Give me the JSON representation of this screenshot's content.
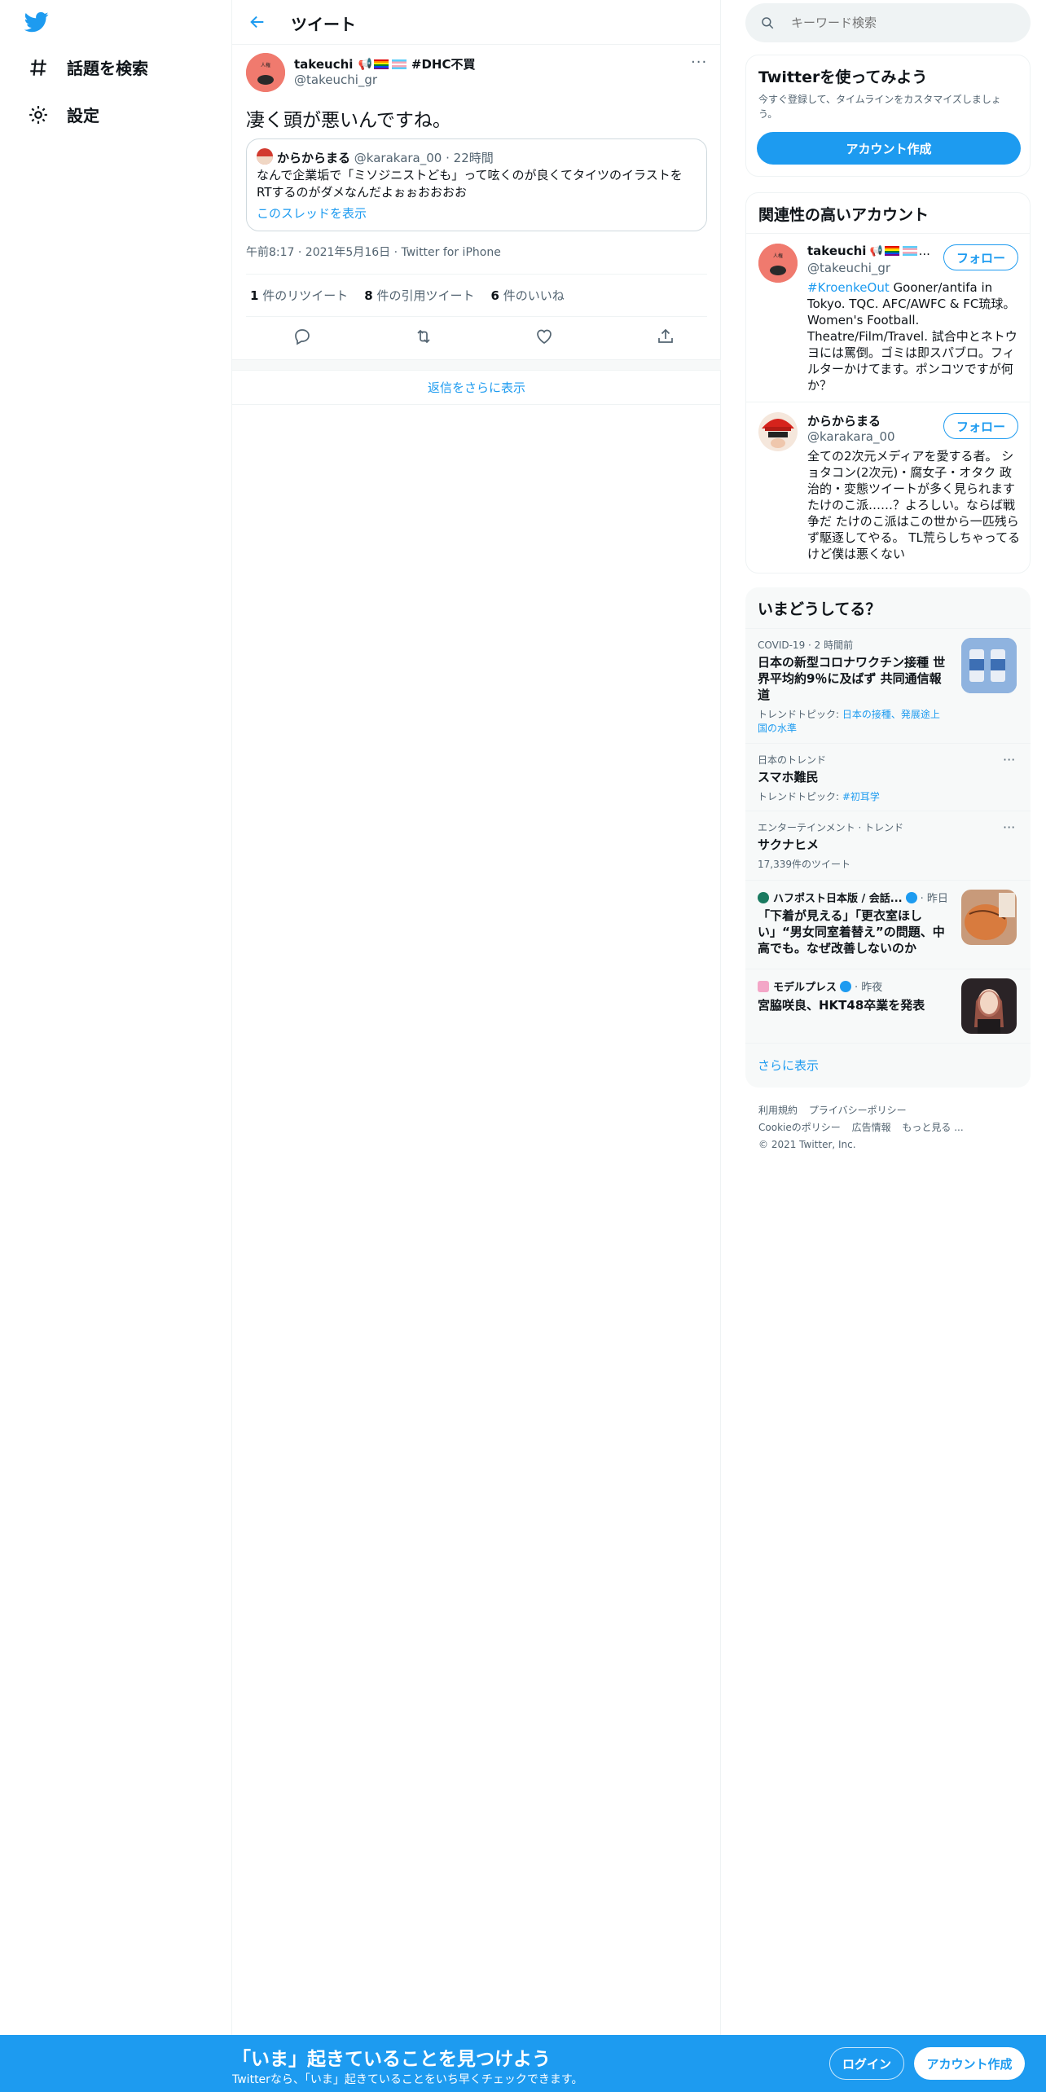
{
  "nav": {
    "explore_label": "話題を検索",
    "settings_label": "設定"
  },
  "header": {
    "title": "ツイート"
  },
  "tweet": {
    "author_name": "takeuchi",
    "author_hashtag": "#DHC不買",
    "author_handle": "@takeuchi_gr",
    "text": "凄く頭が悪いんですね。",
    "quote": {
      "name": "からからまる",
      "handle": "@karakara_00",
      "time": "· 22時間",
      "text": "なんで企業垢で「ミソジニストども」って呟くのが良くてタイツのイラストをRTするのがダメなんだよぉぉおおおお",
      "show_thread": "このスレッドを表示"
    },
    "meta": "午前8:17 · 2021年5月16日 · Twitter for iPhone",
    "stats": [
      {
        "num": "1",
        "label": "件のリツイート"
      },
      {
        "num": "8",
        "label": "件の引用ツイート"
      },
      {
        "num": "6",
        "label": "件のいいね"
      }
    ],
    "show_more_replies": "返信をさらに表示"
  },
  "search": {
    "placeholder": "キーワード検索"
  },
  "signup_card": {
    "title": "Twitterを使ってみよう",
    "subtitle": "今すぐ登録して、タイムラインをカスタマイズしましょう。",
    "button": "アカウント作成"
  },
  "related": {
    "title": "関連性の高いアカウント",
    "accounts": [
      {
        "name": "takeuchi",
        "name_suffix": "...",
        "handle": "@takeuchi_gr",
        "bio_tag": "#KroenkeOut",
        "bio": "Gooner/antifa in Tokyo. TQC. AFC/AWFC & FC琉球。Women's Football. Theatre/Film/Travel. 試合中とネトウヨには罵倒。ゴミは即スパブロ。フィルターかけてます。ポンコツですが何か？",
        "follow": "フォロー"
      },
      {
        "name": "からからまる",
        "handle": "@karakara_00",
        "bio": "全ての2次元メディアを愛する者。 ショタコン(2次元)・腐女子・オタク 政治的・変態ツイートが多く見られますたけのこ派……？よろしい。ならば戦争だ たけのこ派はこの世から一匹残らず駆逐してやる。 TL荒らしちゃってるけど僕は悪くない",
        "follow": "フォロー"
      }
    ]
  },
  "trends": {
    "title": "いまどうしてる？",
    "items": [
      {
        "context": "COVID-19 · 2 時間前",
        "headline": "日本の新型コロナワクチン接種 世界平均約9％に及ばず 共同通信報道",
        "topics_label": "トレンドトピック: ",
        "topics": "日本の接種、発展途上国の水準"
      },
      {
        "context": "日本のトレンド",
        "headline": "スマホ難民",
        "topics_label": "トレンドトピック: ",
        "topics": "#初耳学"
      },
      {
        "context": "エンターテインメント · トレンド",
        "headline": "サクナヒメ",
        "count": "17,339件のツイート"
      },
      {
        "source": "ハフポスト日本版 / 会話...",
        "time": "· 昨日",
        "headline": "「下着が見える」「更衣室ほしい」“男女同室着替え”の問題、中高でも。なぜ改善しないのか"
      },
      {
        "source": "モデルプレス",
        "time": "· 昨夜",
        "headline": "宮脇咲良、HKT48卒業を発表"
      }
    ],
    "show_more": "さらに表示"
  },
  "footer": {
    "line1": [
      "利用規約",
      "プライバシーポリシー"
    ],
    "line2": [
      "Cookieのポリシー",
      "広告情報",
      "もっと見る ..."
    ],
    "copyright": "© 2021 Twitter, Inc."
  },
  "bottom_bar": {
    "headline": "「いま」起きていることを見つけよう",
    "sub": "Twitterなら、「いま」起きていることをいち早くチェックできます。",
    "login": "ログイン",
    "signup": "アカウント作成"
  },
  "colors": {
    "accent": "#1d9bf0",
    "text": "#0f1419",
    "muted": "#536471"
  }
}
